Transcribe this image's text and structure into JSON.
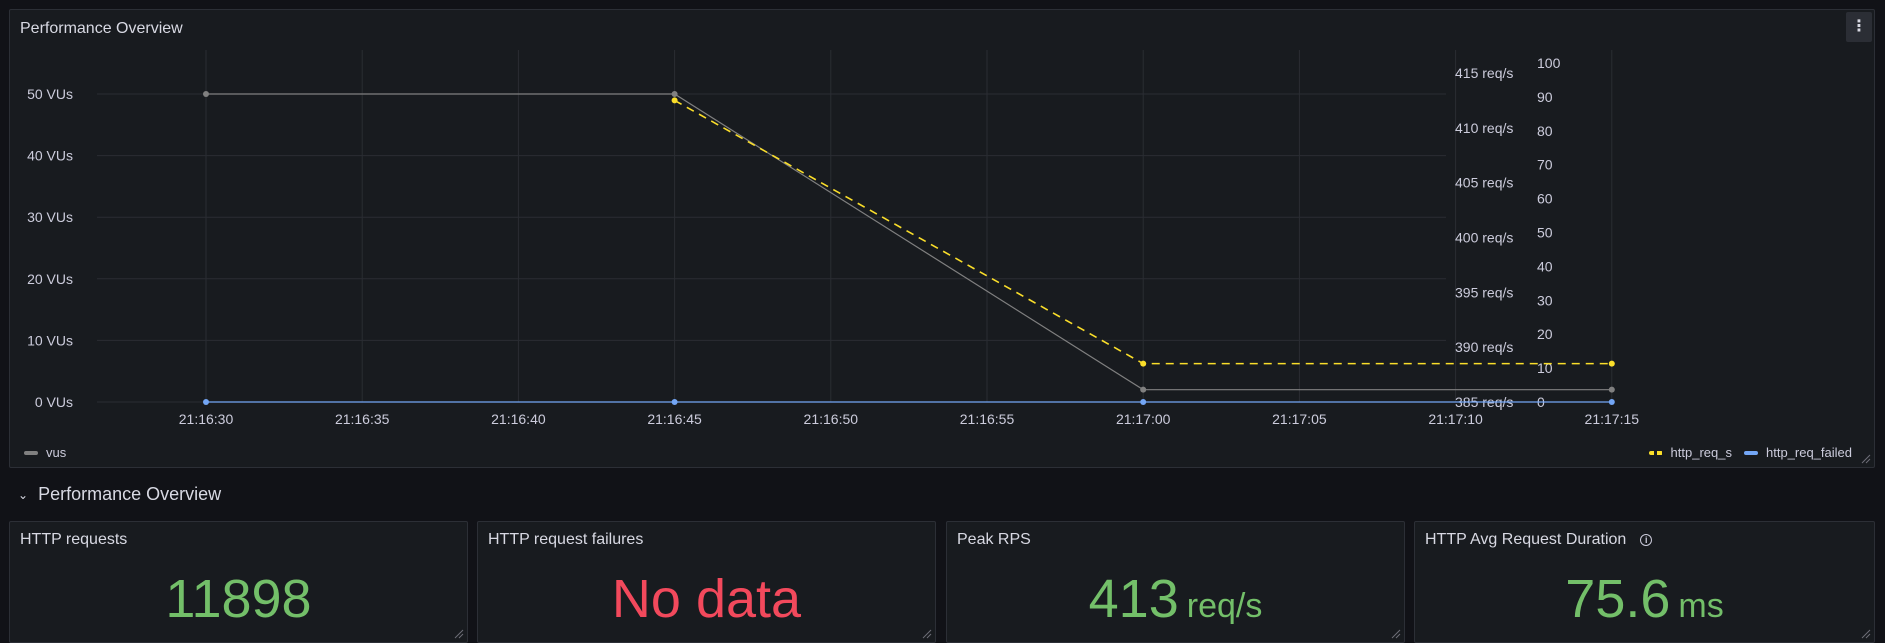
{
  "colors": {
    "vus": "#808080",
    "http_req_s": "#fade2a",
    "http_req_failed": "#73a6f5",
    "stat_green": "#73bf69",
    "stat_red": "#f2495c"
  },
  "top_panel": {
    "title": "Performance Overview",
    "menu_icon": "vertical-dots-icon"
  },
  "chart_data": {
    "type": "line",
    "x": [
      "21:16:30",
      "21:16:45",
      "21:17:00",
      "21:17:15"
    ],
    "x_ticks": [
      "21:16:30",
      "21:16:35",
      "21:16:40",
      "21:16:45",
      "21:16:50",
      "21:16:55",
      "21:17:00",
      "21:17:05",
      "21:17:10",
      "21:17:15"
    ],
    "y_left_ticks": [
      "0 VUs",
      "10 VUs",
      "20 VUs",
      "30 VUs",
      "40 VUs",
      "50 VUs"
    ],
    "y_left_range": [
      0,
      50
    ],
    "y_right1_ticks": [
      "385 req/s",
      "390 req/s",
      "395 req/s",
      "400 req/s",
      "405 req/s",
      "410 req/s",
      "415 req/s"
    ],
    "y_right1_range": [
      385,
      415
    ],
    "y_right2_ticks": [
      "0",
      "10",
      "20",
      "30",
      "40",
      "50",
      "60",
      "70",
      "80",
      "90",
      "100"
    ],
    "y_right2_range": [
      0,
      100
    ],
    "series": [
      {
        "name": "vus",
        "axis": "left",
        "values": [
          50,
          50,
          2,
          2
        ],
        "style": "solid"
      },
      {
        "name": "http_req_s",
        "axis": "right1",
        "values": [
          null,
          412.5,
          388.5,
          388.5
        ],
        "style": "dashed"
      },
      {
        "name": "http_req_failed",
        "axis": "right2",
        "values": [
          0,
          0,
          0,
          0
        ],
        "style": "solid"
      }
    ],
    "grid": true,
    "legend_left": [
      "vus"
    ],
    "legend_right": [
      "http_req_s",
      "http_req_failed"
    ]
  },
  "row": {
    "title": "Performance Overview",
    "chevron_icon": "chevron-down-icon"
  },
  "stats": [
    {
      "title": "HTTP requests",
      "value": "11898",
      "unit": "",
      "color": "#73bf69",
      "info": false
    },
    {
      "title": "HTTP request failures",
      "value": "No data",
      "unit": "",
      "color": "#f2495c",
      "info": false
    },
    {
      "title": "Peak RPS",
      "value": "413",
      "unit": "req/s",
      "color": "#73bf69",
      "info": true
    },
    {
      "title": "HTTP Avg Request Duration",
      "value": "75.6",
      "unit": "ms",
      "color": "#73bf69",
      "info": true
    }
  ]
}
